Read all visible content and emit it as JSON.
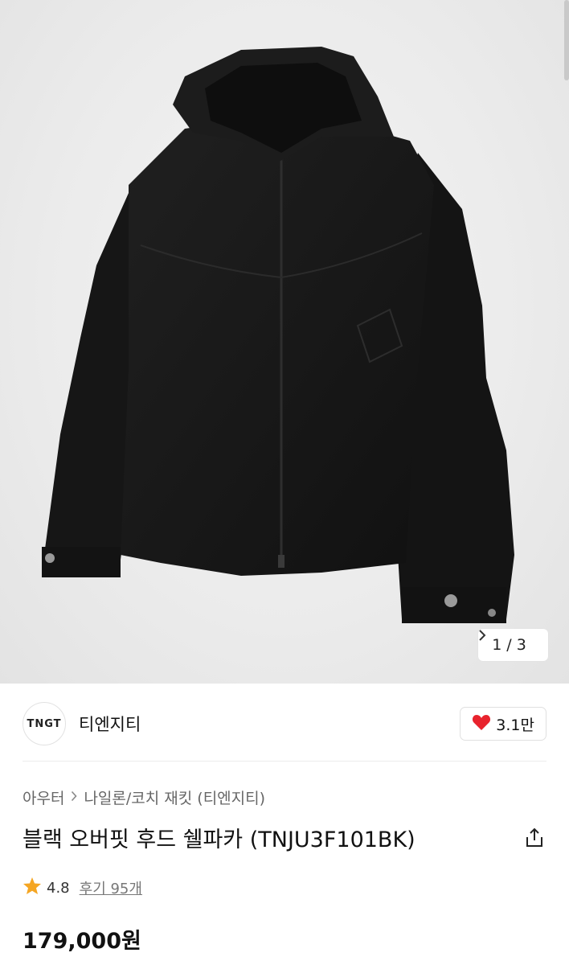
{
  "gallery": {
    "current_index": "1",
    "separator": "/",
    "total": "3",
    "next_icon": "chevron-right-icon"
  },
  "brand": {
    "logo_text": "TNGT",
    "name": "티엔지티",
    "like_count": "3.1만",
    "like_icon": "heart-icon",
    "like_color": "#e8232d"
  },
  "breadcrumb": {
    "items": [
      "아우터",
      "나일론/코치 재킷 (티엔지티)"
    ]
  },
  "product": {
    "title": "블랙 오버핏 후드 쉘파카 (TNJU3F101BK)",
    "rating": "4.8",
    "review_text": "후기 95개",
    "price": "179,000원",
    "star_color": "#f5a623"
  }
}
